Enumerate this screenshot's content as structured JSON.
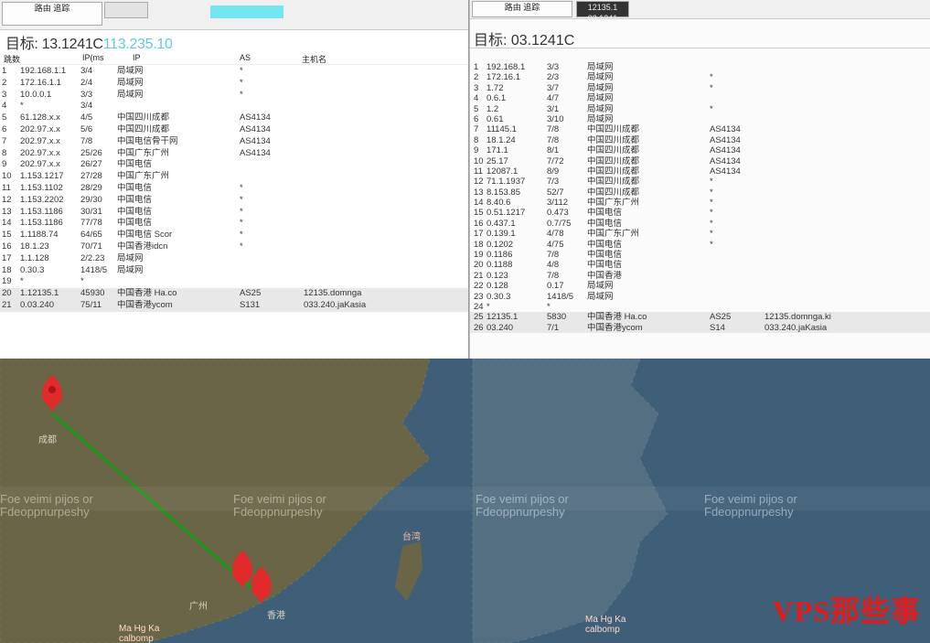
{
  "left_pane": {
    "tabs": [
      {
        "label": "路由\n追踪",
        "active": true
      },
      {
        "label": "",
        "active": false
      }
    ],
    "highlight_text": "",
    "title_prefix": "目标: 13.1241C",
    "title_ip": "113.235.10",
    "headers": [
      "跳数",
      "IP(ms",
      "IP",
      "AS",
      "主机名"
    ],
    "rows": [
      {
        "hop": "1",
        "rtt": "3/4",
        "ip": "192.168.1.1",
        "loc": "局域网",
        "as": "*",
        "host": ""
      },
      {
        "hop": "2",
        "rtt": "2/4",
        "ip": "172.16.1.1",
        "loc": "局域网",
        "as": "*",
        "host": ""
      },
      {
        "hop": "3",
        "rtt": "3/3",
        "ip": "10.0.0.1",
        "loc": "局域网",
        "as": "*",
        "host": ""
      },
      {
        "hop": "4",
        "rtt": "3/4",
        "ip": "*",
        "loc": "",
        "as": "",
        "host": ""
      },
      {
        "hop": "5",
        "rtt": "4/5",
        "ip": "61.128.x.x",
        "loc": "中国四川成都",
        "as": "AS4134",
        "host": ""
      },
      {
        "hop": "6",
        "rtt": "5/6",
        "ip": "202.97.x.x",
        "loc": "中国四川成都",
        "as": "AS4134",
        "host": ""
      },
      {
        "hop": "7",
        "rtt": "7/8",
        "ip": "202.97.x.x",
        "loc": "中国电信骨干网",
        "as": "AS4134",
        "host": ""
      },
      {
        "hop": "8",
        "rtt": "25/26",
        "ip": "202.97.x.x",
        "loc": "中国广东广州",
        "as": "AS4134",
        "host": ""
      },
      {
        "hop": "9",
        "rtt": "26/27",
        "ip": "202.97.x.x",
        "loc": "中国电信",
        "as": "",
        "host": ""
      },
      {
        "hop": "10",
        "rtt": "27/28",
        "ip": "1.153.1217",
        "loc": "中国广东广州",
        "as": "",
        "host": ""
      },
      {
        "hop": "11",
        "rtt": "28/29",
        "ip": "1.153.1102",
        "loc": "中国电信",
        "as": "*",
        "host": ""
      },
      {
        "hop": "12",
        "rtt": "29/30",
        "ip": "1.153.2202",
        "loc": "中国电信",
        "as": "*",
        "host": ""
      },
      {
        "hop": "13",
        "rtt": "30/31",
        "ip": "1.153.1186",
        "loc": "中国电信",
        "as": "*",
        "host": ""
      },
      {
        "hop": "14",
        "rtt": "77/78",
        "ip": "1.153.1186",
        "loc": "中国电信",
        "as": "*",
        "host": ""
      },
      {
        "hop": "15",
        "rtt": "64/65",
        "ip": "1.1188.74",
        "loc": "中国电信 Scor",
        "as": "*",
        "host": ""
      },
      {
        "hop": "16",
        "rtt": "70/71",
        "ip": "18.1.23",
        "loc": "中国香港idcn",
        "as": "*",
        "host": ""
      },
      {
        "hop": "17",
        "rtt": "2/2.23",
        "ip": "1.1.128",
        "loc": "局域网",
        "as": "",
        "host": ""
      },
      {
        "hop": "18",
        "rtt": "1418/5",
        "ip": "0.30.3",
        "loc": "局域网",
        "as": "",
        "host": ""
      },
      {
        "hop": "19",
        "rtt": "*",
        "ip": "*",
        "loc": "",
        "as": "",
        "host": ""
      },
      {
        "hop": "20",
        "rtt": "45930",
        "ip": "1.12135.1",
        "loc": "中国香港 Ha.co",
        "as": "AS25",
        "host": "12135.domnga"
      },
      {
        "hop": "21",
        "rtt": "75/11",
        "ip": "0.03.240",
        "loc": "中国香港ycom",
        "as": "S131",
        "host": "033.240.jaKasia"
      }
    ]
  },
  "right_pane": {
    "tabs": [
      {
        "label": "路由\n追踪",
        "active": true
      },
      {
        "label": "12135.1\n03.1241",
        "active": false
      }
    ],
    "title": "目标: 03.1241C",
    "rows": [
      {
        "hop": "1",
        "ip": "192.168.1",
        "rtt": "3/3",
        "loc": "局域网",
        "as": "",
        "host": ""
      },
      {
        "hop": "2",
        "ip": "172.16.1",
        "rtt": "2/3",
        "loc": "局域网",
        "as": "*",
        "host": ""
      },
      {
        "hop": "3",
        "ip": "1.72",
        "rtt": "3/7",
        "loc": "局域网",
        "as": "*",
        "host": ""
      },
      {
        "hop": "4",
        "ip": "0.6.1",
        "rtt": "4/7",
        "loc": "局域网",
        "as": "",
        "host": ""
      },
      {
        "hop": "5",
        "ip": "1.2",
        "rtt": "3/1",
        "loc": "局域网",
        "as": "*",
        "host": ""
      },
      {
        "hop": "6",
        "ip": "0.61",
        "rtt": "3/10",
        "loc": "局域网",
        "as": "",
        "host": ""
      },
      {
        "hop": "7",
        "ip": "11145.1",
        "rtt": "7/8",
        "loc": "中国四川成都",
        "as": "AS4134",
        "host": ""
      },
      {
        "hop": "8",
        "ip": "18.1.24",
        "rtt": "7/8",
        "loc": "中国四川成都",
        "as": "AS4134",
        "host": ""
      },
      {
        "hop": "9",
        "ip": "171.1",
        "rtt": "8/1",
        "loc": "中国四川成都",
        "as": "AS4134",
        "host": ""
      },
      {
        "hop": "10",
        "ip": "25.17",
        "rtt": "7/72",
        "loc": "中国四川成都",
        "as": "AS4134",
        "host": ""
      },
      {
        "hop": "11",
        "ip": "12087.1",
        "rtt": "8/9",
        "loc": "中国四川成都",
        "as": "AS4134",
        "host": ""
      },
      {
        "hop": "12",
        "ip": "71.1.1937",
        "rtt": "7/3",
        "loc": "中国四川成都",
        "as": "*",
        "host": ""
      },
      {
        "hop": "13",
        "ip": "8.153.85",
        "rtt": "52/7",
        "loc": "中国四川成都",
        "as": "*",
        "host": ""
      },
      {
        "hop": "14",
        "ip": "8.40.6",
        "rtt": "3/112",
        "loc": "中国广东广州",
        "as": "*",
        "host": ""
      },
      {
        "hop": "15",
        "ip": "0.51.1217",
        "rtt": "0.473",
        "loc": "中国电信",
        "as": "*",
        "host": ""
      },
      {
        "hop": "16",
        "ip": "0.437.1",
        "rtt": "0.7/75",
        "loc": "中国电信",
        "as": "*",
        "host": ""
      },
      {
        "hop": "17",
        "ip": "0.139.1",
        "rtt": "4/78",
        "loc": "中国广东广州",
        "as": "*",
        "host": ""
      },
      {
        "hop": "18",
        "ip": "0.1202",
        "rtt": "4/75",
        "loc": "中国电信",
        "as": "*",
        "host": ""
      },
      {
        "hop": "19",
        "ip": "0.1186",
        "rtt": "7/8",
        "loc": "中国电信",
        "as": "",
        "host": ""
      },
      {
        "hop": "20",
        "ip": "0.1188",
        "rtt": "4/8",
        "loc": "中国电信",
        "as": "",
        "host": ""
      },
      {
        "hop": "21",
        "ip": "0.123",
        "rtt": "7/8",
        "loc": "中国香港",
        "as": "",
        "host": ""
      },
      {
        "hop": "22",
        "ip": "0.128",
        "rtt": "0.17",
        "loc": "局域网",
        "as": "",
        "host": ""
      },
      {
        "hop": "23",
        "ip": "0.30.3",
        "rtt": "1418/5",
        "loc": "局域网",
        "as": "",
        "host": ""
      },
      {
        "hop": "24",
        "ip": "*",
        "rtt": "*",
        "loc": "",
        "as": "",
        "host": ""
      },
      {
        "hop": "25",
        "ip": "12135.1",
        "rtt": "5830",
        "loc": "中国香港 Ha.co",
        "as": "AS25",
        "host": "12135.domnga.ki"
      },
      {
        "hop": "26",
        "ip": "03.240",
        "rtt": "7/1",
        "loc": "中国香港ycom",
        "as": "S14",
        "host": "033.240.jaKasia"
      }
    ]
  },
  "map": {
    "watermark": "VPS那些事",
    "route_color": "#1a9a1a",
    "pin_color": "#e32a2a",
    "overlay_text": "Foe veimi pijos or",
    "overlay_text2": "Fdeoppnurpeshy",
    "labels": [
      "成都",
      "广州",
      "香港",
      "台湾"
    ],
    "dest_label": "Ma Hg Ka\ncalbomp"
  }
}
